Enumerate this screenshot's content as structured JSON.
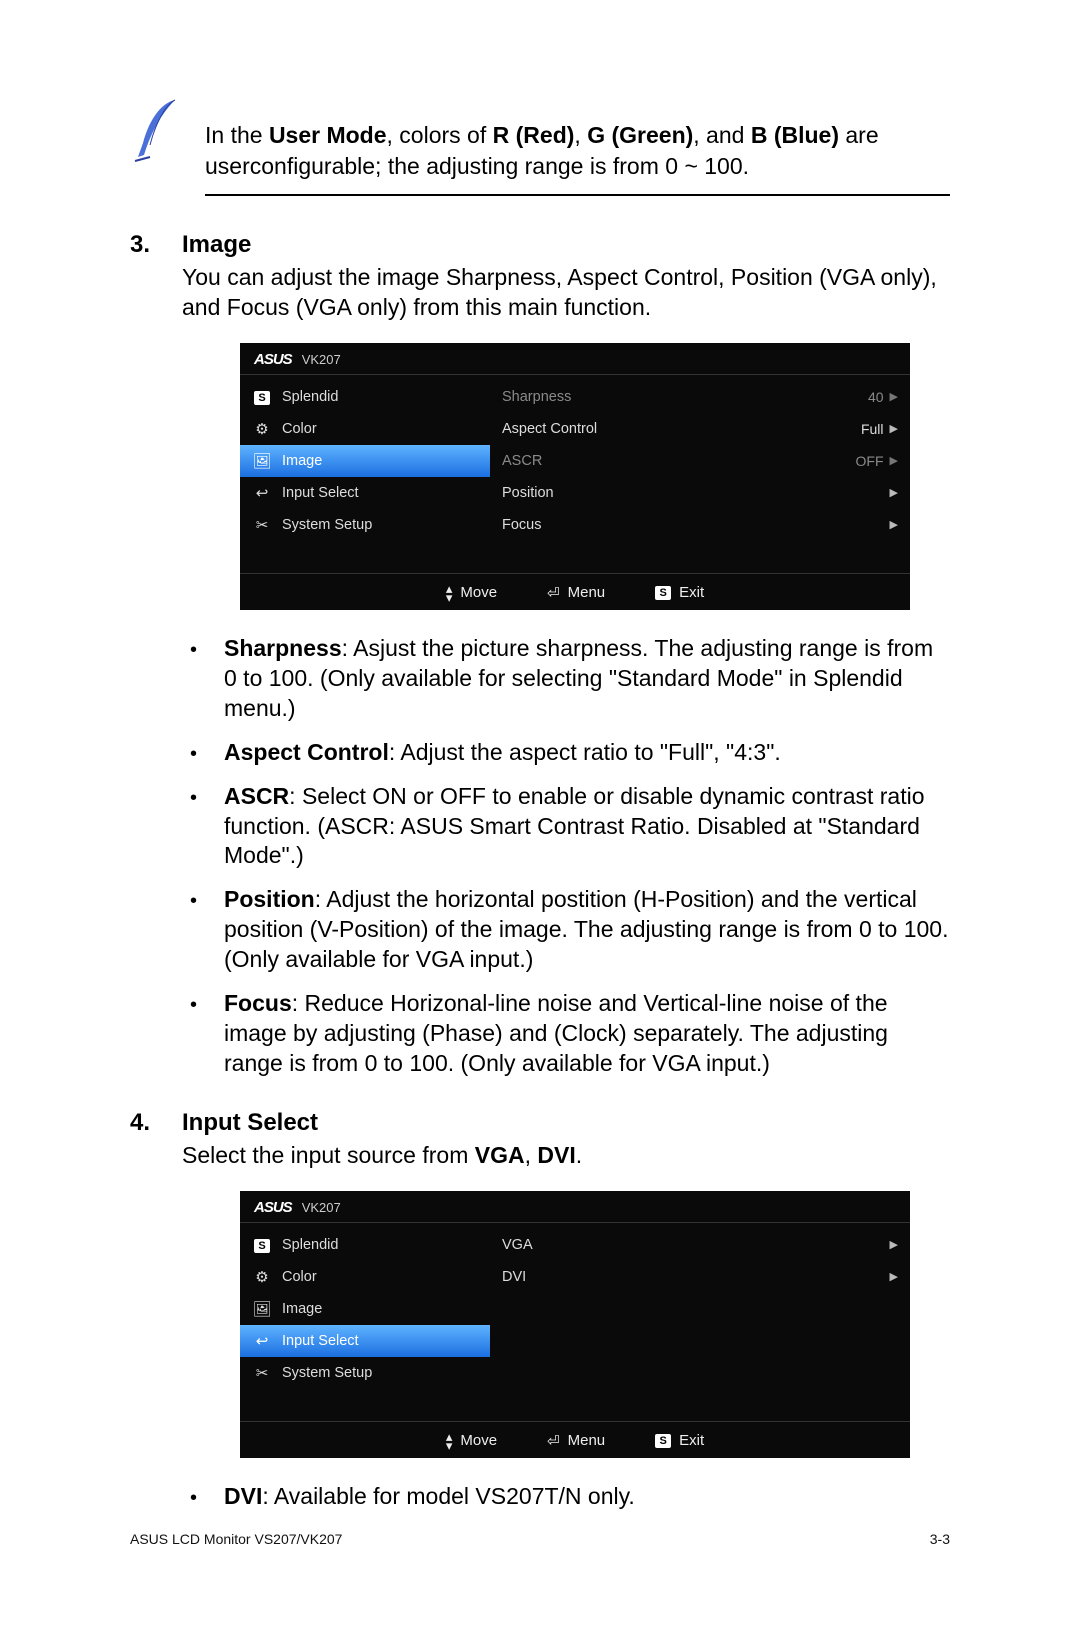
{
  "note": {
    "pre": "In the ",
    "b1": "User Mode",
    "mid1": ", colors of ",
    "b2": "R (Red)",
    "mid2": ", ",
    "b3": "G (Green)",
    "mid3": ", and ",
    "b4": "B (Blue)",
    "tail": " are userconfigurable; the adjusting range is from 0 ~ 100."
  },
  "sec3": {
    "num": "3.",
    "title": "Image",
    "desc": "You can adjust the image Sharpness, Aspect Control, Position (VGA only), and Focus (VGA only) from this main function."
  },
  "osd1": {
    "brand": "ASUS",
    "model": "VK207",
    "side": [
      {
        "icon": "S",
        "label": "Splendid",
        "sel": false
      },
      {
        "icon": "⚙",
        "label": "Color",
        "sel": false
      },
      {
        "icon": "🖼",
        "label": "Image",
        "sel": true
      },
      {
        "icon": "↩",
        "label": "Input Select",
        "sel": false
      },
      {
        "icon": "✂",
        "label": "System Setup",
        "sel": false
      }
    ],
    "content": [
      {
        "label": "Sharpness",
        "value": "40",
        "dim": true,
        "arrow": true
      },
      {
        "label": "Aspect Control",
        "value": "Full",
        "dim": false,
        "arrow": true
      },
      {
        "label": "ASCR",
        "value": "OFF",
        "dim": true,
        "arrow": true
      },
      {
        "label": "Position",
        "value": "",
        "dim": false,
        "arrow": true
      },
      {
        "label": "Focus",
        "value": "",
        "dim": false,
        "arrow": true
      }
    ],
    "footer": {
      "move": "Move",
      "menu": "Menu",
      "exit": "Exit"
    }
  },
  "bullets3": [
    {
      "head": "Sharpness",
      "text": ": Asjust the picture sharpness. The adjusting range is from 0 to 100. (Only available for selecting \"Standard Mode\" in Splendid menu.)"
    },
    {
      "head": "Aspect Control",
      "text": ": Adjust the aspect ratio to \"Full\", \"4:3\"."
    },
    {
      "head": "ASCR",
      "text": ": Select ON or OFF to enable or disable dynamic contrast ratio function. (ASCR: ASUS Smart Contrast Ratio. Disabled at \"Standard Mode\".)"
    },
    {
      "head": "Position",
      "text": ": Adjust the horizontal postition (H-Position) and the vertical position (V-Position) of the image. The adjusting range is from 0 to 100. (Only available for VGA input.)"
    },
    {
      "head": "Focus",
      "text": ": Reduce Horizonal-line noise and Vertical-line noise of the image by adjusting (Phase) and (Clock) separately. The adjusting range is from 0 to 100. (Only available for VGA input.)"
    }
  ],
  "sec4": {
    "num": "4.",
    "title": "Input Select",
    "desc_pre": "Select the input source from ",
    "desc_b1": "VGA",
    "desc_mid": ", ",
    "desc_b2": "DVI",
    "desc_post": "."
  },
  "osd2": {
    "brand": "ASUS",
    "model": "VK207",
    "side": [
      {
        "icon": "S",
        "label": "Splendid",
        "sel": false
      },
      {
        "icon": "⚙",
        "label": "Color",
        "sel": false
      },
      {
        "icon": "🖼",
        "label": "Image",
        "sel": false
      },
      {
        "icon": "↩",
        "label": "Input Select",
        "sel": true
      },
      {
        "icon": "✂",
        "label": "System Setup",
        "sel": false
      }
    ],
    "content": [
      {
        "label": "VGA",
        "value": "",
        "dim": false,
        "arrow": true
      },
      {
        "label": "DVI",
        "value": "",
        "dim": false,
        "arrow": true
      }
    ],
    "footer": {
      "move": "Move",
      "menu": "Menu",
      "exit": "Exit"
    }
  },
  "bullets4": [
    {
      "head": "DVI",
      "text": ": Available for model VS207T/N only."
    }
  ],
  "footer": {
    "left": "ASUS LCD Monitor VS207/VK207",
    "right": "3-3"
  }
}
